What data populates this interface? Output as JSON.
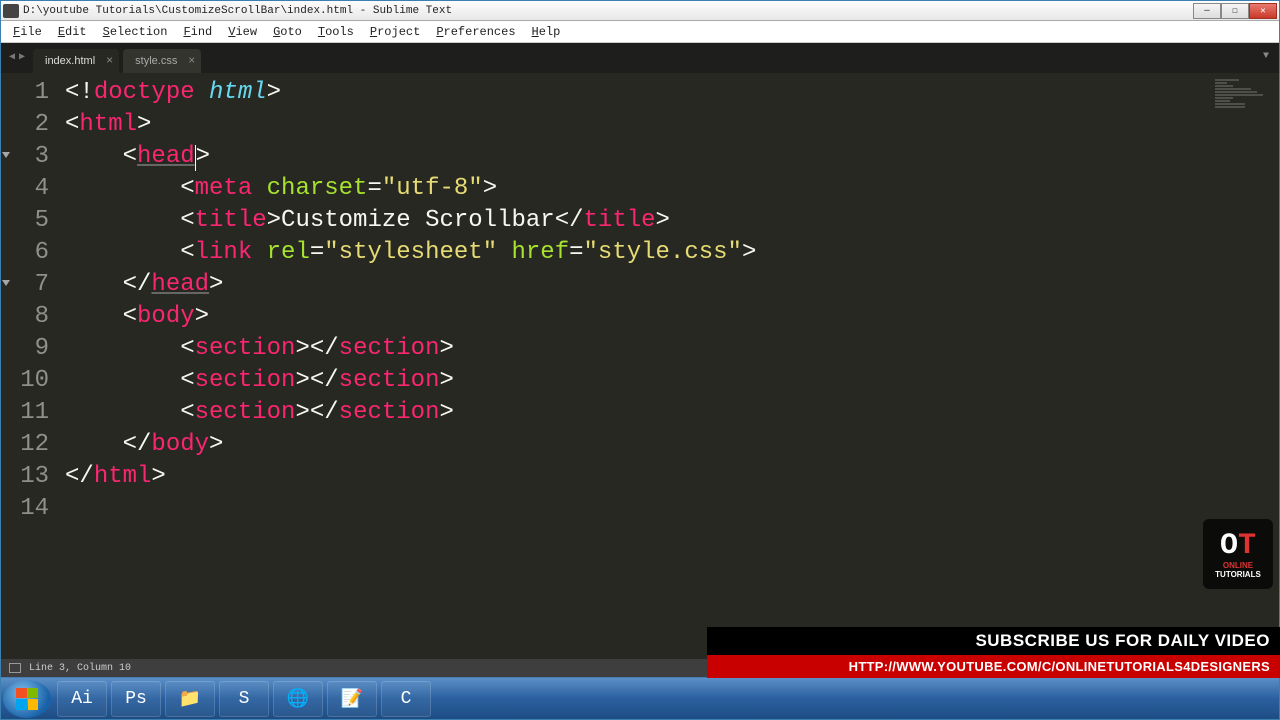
{
  "window": {
    "title": "D:\\youtube Tutorials\\CustomizeScrollBar\\index.html - Sublime Text"
  },
  "menu": [
    "File",
    "Edit",
    "Selection",
    "Find",
    "View",
    "Goto",
    "Tools",
    "Project",
    "Preferences",
    "Help"
  ],
  "tabs": [
    {
      "label": "index.html",
      "active": true
    },
    {
      "label": "style.css",
      "active": false
    }
  ],
  "code": {
    "lines": [
      {
        "n": 1,
        "t": [
          [
            "punct",
            "<!"
          ],
          [
            "tag",
            "doctype "
          ],
          [
            "kw",
            "html"
          ],
          [
            "punct",
            ">"
          ]
        ]
      },
      {
        "n": 2,
        "t": [
          [
            "punct",
            "<"
          ],
          [
            "tag",
            "html"
          ],
          [
            "punct",
            ">"
          ]
        ]
      },
      {
        "n": 3,
        "fold": true,
        "t": [
          [
            "punct",
            "    <"
          ],
          [
            "tag",
            "head"
          ],
          [
            "cursor",
            ""
          ],
          [
            "punct",
            ">"
          ]
        ],
        "uhead": true
      },
      {
        "n": 4,
        "t": [
          [
            "punct",
            "        <"
          ],
          [
            "tag",
            "meta "
          ],
          [
            "attr",
            "charset"
          ],
          [
            "punct",
            "="
          ],
          [
            "str",
            "\"utf-8\""
          ],
          [
            "punct",
            ">"
          ]
        ]
      },
      {
        "n": 5,
        "t": [
          [
            "punct",
            "        <"
          ],
          [
            "tag",
            "title"
          ],
          [
            "punct",
            ">"
          ],
          [
            "txt",
            "Customize Scrollbar"
          ],
          [
            "punct",
            "</"
          ],
          [
            "tag",
            "title"
          ],
          [
            "punct",
            ">"
          ]
        ]
      },
      {
        "n": 6,
        "t": [
          [
            "punct",
            "        <"
          ],
          [
            "tag",
            "link "
          ],
          [
            "attr",
            "rel"
          ],
          [
            "punct",
            "="
          ],
          [
            "str",
            "\"stylesheet\""
          ],
          [
            "punct",
            " "
          ],
          [
            "attr",
            "href"
          ],
          [
            "punct",
            "="
          ],
          [
            "str",
            "\"style.css\""
          ],
          [
            "punct",
            ">"
          ]
        ]
      },
      {
        "n": 7,
        "fold": true,
        "t": [
          [
            "punct",
            "    </"
          ],
          [
            "tag",
            "head"
          ],
          [
            "punct",
            ">"
          ]
        ],
        "uhead": true
      },
      {
        "n": 8,
        "t": [
          [
            "punct",
            "    <"
          ],
          [
            "tag",
            "body"
          ],
          [
            "punct",
            ">"
          ]
        ]
      },
      {
        "n": 9,
        "t": [
          [
            "punct",
            "        <"
          ],
          [
            "tag",
            "section"
          ],
          [
            "punct",
            "></"
          ],
          [
            "tag",
            "section"
          ],
          [
            "punct",
            ">"
          ]
        ]
      },
      {
        "n": 10,
        "t": [
          [
            "punct",
            "        <"
          ],
          [
            "tag",
            "section"
          ],
          [
            "punct",
            "></"
          ],
          [
            "tag",
            "section"
          ],
          [
            "punct",
            ">"
          ]
        ]
      },
      {
        "n": 11,
        "t": [
          [
            "punct",
            "        <"
          ],
          [
            "tag",
            "section"
          ],
          [
            "punct",
            "></"
          ],
          [
            "tag",
            "section"
          ],
          [
            "punct",
            ">"
          ]
        ]
      },
      {
        "n": 12,
        "t": [
          [
            "punct",
            "    </"
          ],
          [
            "tag",
            "body"
          ],
          [
            "punct",
            ">"
          ]
        ]
      },
      {
        "n": 13,
        "t": [
          [
            "punct",
            "</"
          ],
          [
            "tag",
            "html"
          ],
          [
            "punct",
            ">"
          ]
        ]
      },
      {
        "n": 14,
        "t": []
      }
    ]
  },
  "status": {
    "pos": "Line 3, Column 10"
  },
  "taskbar_apps": [
    "Ai",
    "Ps",
    "📁",
    "S",
    "🌐",
    "📝",
    "C"
  ],
  "banner": {
    "line1": "SUBSCRIBE US FOR DAILY VIDEO",
    "line2": "HTTP://WWW.YOUTUBE.COM/C/ONLINETUTORIALS4DESIGNERS"
  },
  "logo": {
    "big1": "O",
    "big2": "T",
    "sub1": "ONLINE",
    "sub2": "TUTORIALS"
  }
}
